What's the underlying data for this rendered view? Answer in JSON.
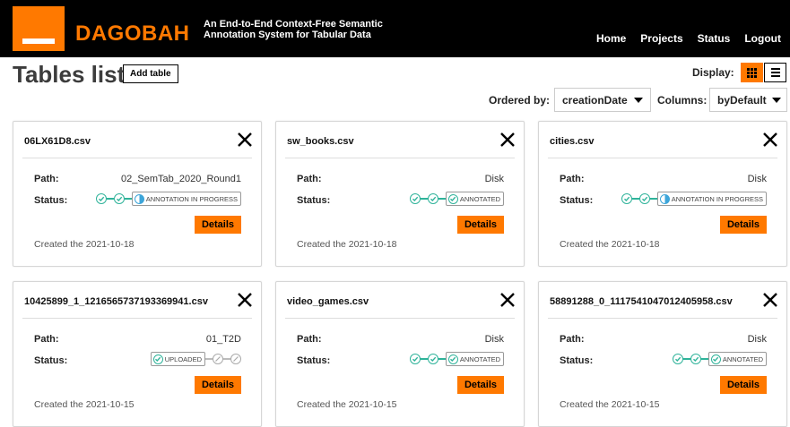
{
  "header": {
    "brand": "DAGOBAH",
    "tagline": "An End-to-End Context-Free Semantic Annotation System for Tabular Data",
    "nav": [
      "Home",
      "Projects",
      "Status",
      "Logout"
    ],
    "accent": "#ff7900"
  },
  "toolbar": {
    "title": "Tables list",
    "add_label": "Add table",
    "display_label": "Display:",
    "ordered_label": "Ordered by:",
    "ordered_value": "creationDate",
    "columns_label": "Columns:",
    "columns_value": "byDefault"
  },
  "labels": {
    "path": "Path:",
    "status": "Status:",
    "details": "Details"
  },
  "cards": [
    {
      "name": "06LX61D8.csv",
      "path": "02_SemTab_2020_Round1",
      "status": "ANNOTATION IN PROGRESS",
      "created": "Created the 2021-10-18"
    },
    {
      "name": "sw_books.csv",
      "path": "Disk",
      "status": "ANNOTATED",
      "created": "Created the 2021-10-18"
    },
    {
      "name": "cities.csv",
      "path": "Disk",
      "status": "ANNOTATION IN PROGRESS",
      "created": "Created the 2021-10-18"
    },
    {
      "name": "10425899_1_1216565737193369941.csv",
      "path": "01_T2D",
      "status": "UPLOADED",
      "created": "Created the 2021-10-15"
    },
    {
      "name": "video_games.csv",
      "path": "Disk",
      "status": "ANNOTATED",
      "created": "Created the 2021-10-15"
    },
    {
      "name": "58891288_0_1117541047012405958.csv",
      "path": "Disk",
      "status": "ANNOTATED",
      "created": "Created the 2021-10-15"
    }
  ]
}
